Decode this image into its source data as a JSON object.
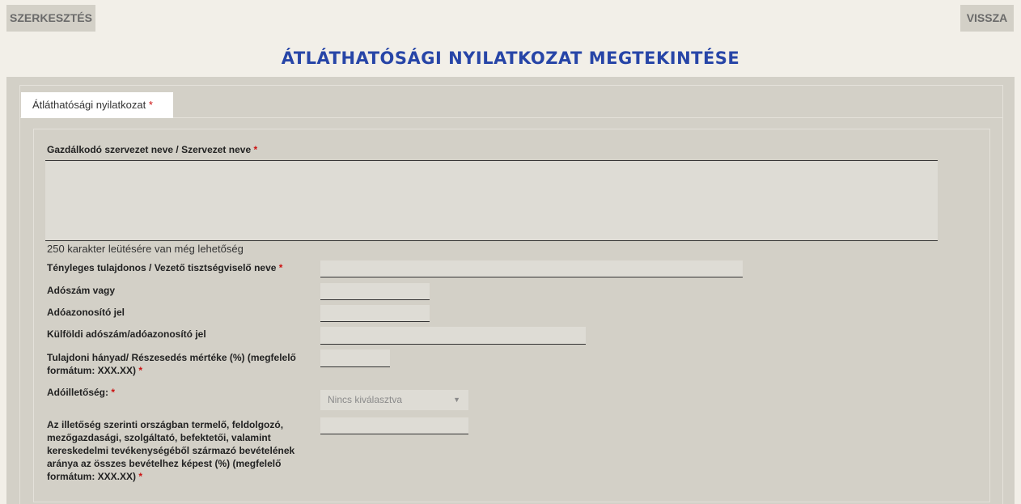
{
  "toolbar": {
    "edit_label": "SZERKESZTÉS",
    "back_label": "VISSZA"
  },
  "page": {
    "title": "ÁTLÁTHATÓSÁGI NYILATKOZAT MEGTEKINTÉSE"
  },
  "tabs": [
    {
      "label": "Átláthatósági nyilatkozat",
      "required_mark": "*"
    }
  ],
  "form": {
    "org_name_label": "Gazdálkodó szervezet neve / Szervezet neve",
    "org_name_value": "",
    "char_hint": "250 karakter leütésére van még lehetőség",
    "owner_label": "Tényleges tulajdonos / Vezető tisztségviselő neve",
    "owner_value": "",
    "tax_number_label": "Adószám vagy",
    "tax_number_value": "",
    "tax_id_label": "Adóazonosító jel",
    "tax_id_value": "",
    "foreign_tax_label": "Külföldi adószám/adóazonosító jel",
    "foreign_tax_value": "",
    "ownership_label": "Tulajdoni hányad/ Részesedés mértéke (%) (megfelelő formátum: XXX.XX)",
    "ownership_value": "",
    "residency_label": "Adóilletőség:",
    "residency_selected": "Nincs kiválasztva",
    "revenue_label": "Az illetőség szerinti országban termelő, feldolgozó, mezőgazdasági, szolgáltató, befektetői, valamint kereskedelmi tevékenységéből származó bevételének aránya az összes bevételhez képest (%) (megfelelő formátum: XXX.XX)",
    "revenue_value": "",
    "required_mark": "*"
  },
  "colors": {
    "title": "#2745a7",
    "required": "#cc1111",
    "panel": "#d3d0c7",
    "background": "#f2efe8"
  },
  "icons": {
    "select_caret": "caret-down-icon"
  }
}
